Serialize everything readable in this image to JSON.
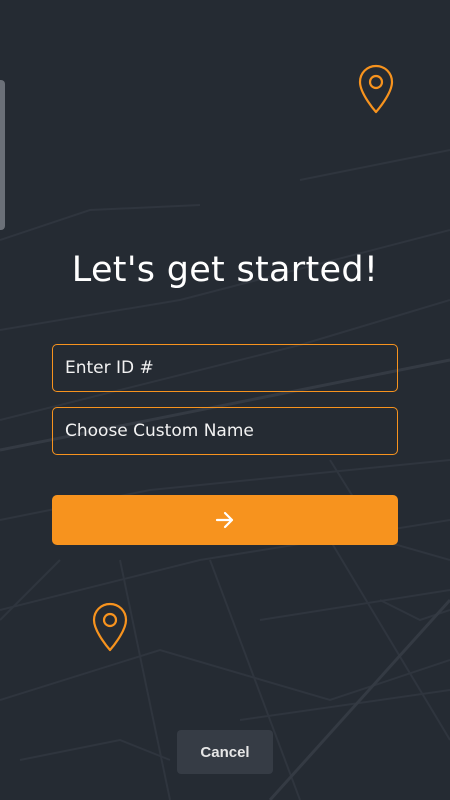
{
  "headline": "Let's get started!",
  "form": {
    "id_field": {
      "value": "",
      "placeholder": "Enter ID #"
    },
    "name_field": {
      "value": "",
      "placeholder": "Choose Custom Name"
    }
  },
  "actions": {
    "submit_icon": "arrow-right-icon",
    "cancel_label": "Cancel"
  },
  "decorations": {
    "pin_icon": "map-pin-icon",
    "background": "street-map-pattern"
  },
  "colors": {
    "background": "#252b33",
    "accent": "#f7931e",
    "text": "#ffffff",
    "cancel_bg": "#363c45"
  }
}
